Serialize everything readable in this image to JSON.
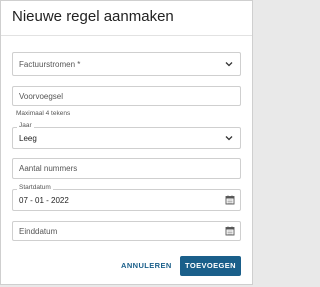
{
  "dialog": {
    "title": "Nieuwe regel aanmaken",
    "fields": {
      "factuurstromen": {
        "placeholder": "Factuurstromen *"
      },
      "voorvoegsel": {
        "placeholder": "Voorvoegsel",
        "hint": "Maximaal 4 tekens"
      },
      "jaar": {
        "label": "Jaar",
        "value": "Leeg"
      },
      "aantal_nummers": {
        "placeholder": "Aantal nummers"
      },
      "startdatum": {
        "label": "Startdatum",
        "value": "07 - 01 - 2022"
      },
      "einddatum": {
        "placeholder": "Einddatum"
      }
    },
    "buttons": {
      "cancel": "ANNULEREN",
      "add": "TOEVOEGEN"
    }
  },
  "icons": {
    "dropdown": "chevron-down-icon",
    "date": "calendar-icon"
  },
  "colors": {
    "primary": "#1a5f8a",
    "border": "#cfcfcf"
  }
}
